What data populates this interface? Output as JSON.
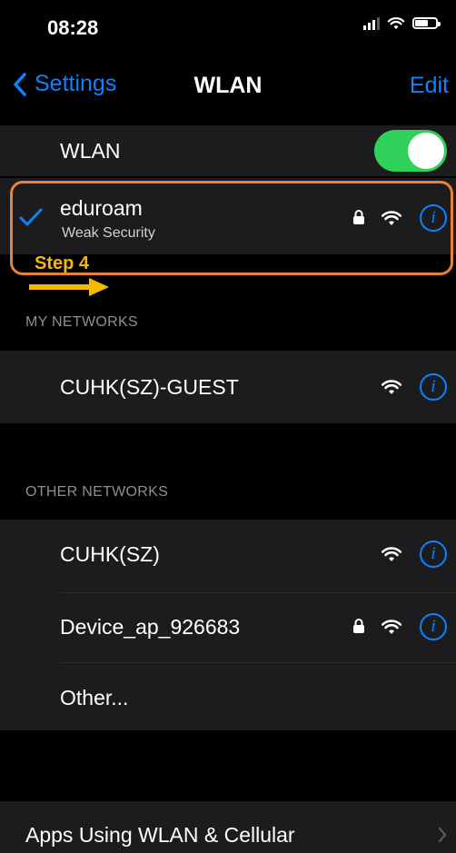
{
  "status_bar": {
    "time": "08:28"
  },
  "nav": {
    "back_label": "Settings",
    "title": "WLAN",
    "edit_label": "Edit"
  },
  "wlan_toggle": {
    "label": "WLAN",
    "on": true
  },
  "connected": {
    "name": "eduroam",
    "subtitle": "Weak Security",
    "secured": true
  },
  "annotation": {
    "step_label": "Step 4",
    "highlight_color": "#e8813a",
    "step_color": "#f5b800"
  },
  "my_networks": {
    "header": "MY NETWORKS",
    "items": [
      {
        "name": "CUHK(SZ)-GUEST",
        "secured": false
      }
    ]
  },
  "other_networks": {
    "header": "OTHER NETWORKS",
    "items": [
      {
        "name": "CUHK(SZ)",
        "secured": false
      },
      {
        "name": "Device_ap_926683",
        "secured": true
      }
    ],
    "other_label": "Other..."
  },
  "apps_row": {
    "label": "Apps Using WLAN & Cellular"
  },
  "colors": {
    "accent": "#0a84ff",
    "toggle_on": "#30d158",
    "row_bg": "#1c1c1e"
  }
}
